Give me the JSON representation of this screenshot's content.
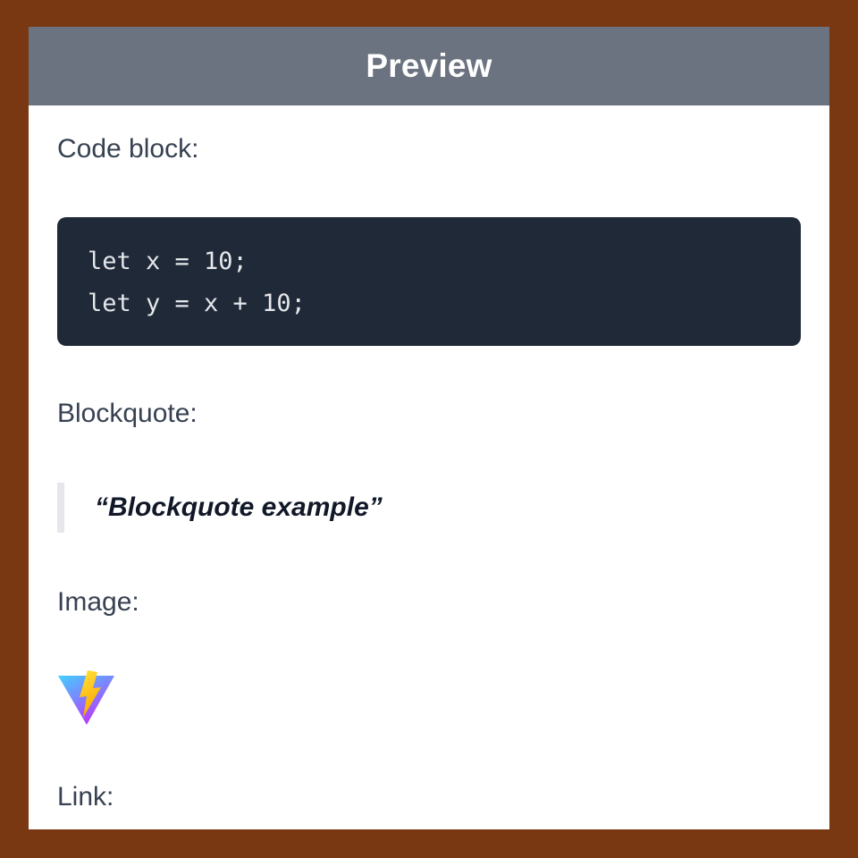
{
  "header": {
    "title": "Preview"
  },
  "sections": {
    "code_label": "Code block:",
    "code_lines": [
      "let x = 10;",
      "let y = x + 10;"
    ],
    "quote_label": "Blockquote:",
    "quote_text": "“Blockquote example”",
    "image_label": "Image:",
    "image_icon": "vite-logo-icon",
    "link_label": "Link:"
  },
  "colors": {
    "page_border": "#7a3812",
    "header_bg": "#6b7280",
    "code_bg": "#1f2937",
    "quote_bar": "#e5e7eb"
  }
}
